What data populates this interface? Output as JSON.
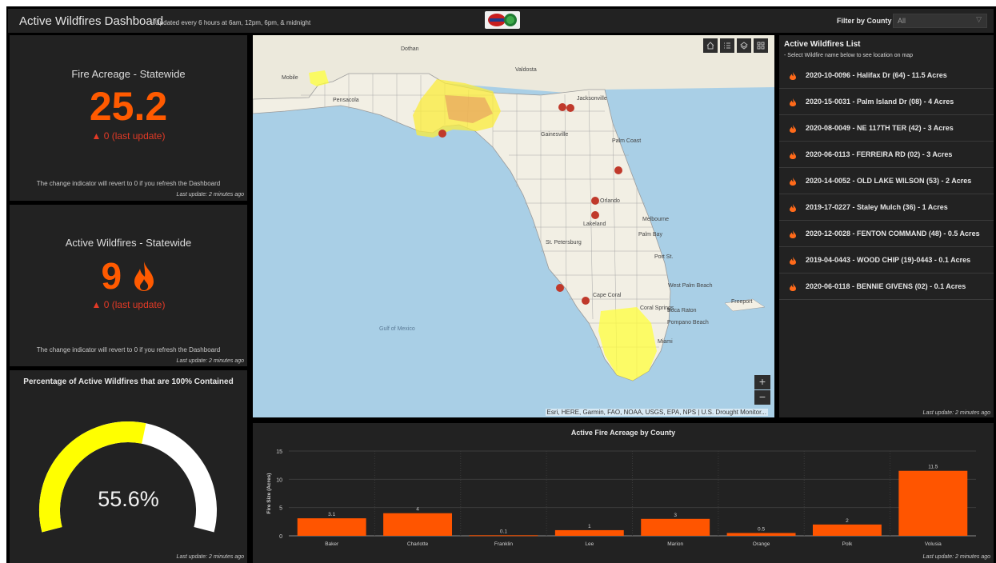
{
  "header": {
    "title": "Active Wildfires Dashboard",
    "subtitle": "- Updated every 6 hours at 6am, 12pm, 6pm, & midnight",
    "filter_label": "Filter by County",
    "filter_value": "All"
  },
  "acreage": {
    "title": "Fire Acreage - Statewide",
    "value": "25.2",
    "change": "▲ 0 (last update)",
    "note": "The change indicator will revert to 0 if you refresh the Dashboard",
    "updated": "Last update: 2 minutes ago"
  },
  "active": {
    "title": "Active Wildfires - Statewide",
    "value": "9",
    "change": "▲ 0 (last update)",
    "note": "The change indicator will revert to 0 if you refresh the Dashboard",
    "updated": "Last update: 2 minutes ago"
  },
  "gauge": {
    "title": "Percentage of Active Wildfires that are 100% Contained",
    "value": "55.6%",
    "fraction": 0.556,
    "fill_color": "#ffff00",
    "track_color": "#ffffff",
    "updated": "Last update: 2 minutes ago"
  },
  "map": {
    "attribution": "Esri, HERE, Garmin, FAO, NOAA, USGS, EPA, NPS | U.S. Drought Monitor...",
    "zoom_in": "+",
    "zoom_out": "−",
    "labels": {
      "dothan": "Dothan",
      "valdosta": "Valdosta",
      "mobile": "Mobile",
      "pensacola": "Pensacola",
      "jacksonville": "Jacksonville",
      "gainesville": "Gainesville",
      "palm_coast": "Palm Coast",
      "orlando": "Orlando",
      "lakeland": "Lakeland",
      "melbourne": "Melbourne",
      "palm_bay": "Palm Bay",
      "st_petersburg": "St. Petersburg",
      "port_st": "Port St.",
      "west_palm_beach": "West Palm Beach",
      "cape_coral": "Cape Coral",
      "coral_springs": "Coral Springs",
      "boca_raton": "Boca Raton",
      "pompano_beach": "Pompano Beach",
      "miami": "Miami",
      "freeport": "Freeport",
      "gulf_of_mexico": "Gulf of Mexico"
    }
  },
  "fire_list": {
    "title": "Active Wildfires List",
    "subtitle": "- Select Wildfire name below to see location on map",
    "items": [
      "2020-10-0096 - Halifax Dr (64) - 11.5 Acres",
      "2020-15-0031 - Palm Island Dr (08) - 4 Acres",
      "2020-08-0049 - NE 117TH TER (42) - 3 Acres",
      "2020-06-0113 - FERREIRA RD (02) - 3 Acres",
      "2020-14-0052 - OLD LAKE WILSON (53) - 2 Acres",
      "2019-17-0227 - Staley Mulch (36) - 1 Acres",
      "2020-12-0028 - FENTON COMMAND (48) - 0.5 Acres",
      "2019-04-0443 - WOOD CHIP (19)-0443 - 0.1 Acres",
      "2020-06-0118 - BENNIE GIVENS (02) - 0.1 Acres"
    ],
    "updated": "Last update: 2 minutes ago"
  },
  "chart": {
    "updated": "Last update: 2 minutes ago"
  },
  "chart_data": {
    "type": "bar",
    "title": "Active Fire Acreage by County",
    "xlabel": "",
    "ylabel": "Fire Size (Acres)",
    "categories": [
      "Baker",
      "Charlotte",
      "Franklin",
      "Lee",
      "Marion",
      "Orange",
      "Polk",
      "Volusia"
    ],
    "values": [
      3.1,
      4,
      0.1,
      1,
      3,
      0.5,
      2,
      11.5
    ],
    "value_labels": [
      "3.1",
      "4",
      "0.1",
      "1",
      "3",
      "0.5",
      "2",
      "11.5"
    ],
    "yticks": [
      "0",
      "5",
      "10",
      "15"
    ],
    "ylim": [
      0,
      15
    ],
    "grid": true,
    "bar_color": "#ff5500"
  }
}
